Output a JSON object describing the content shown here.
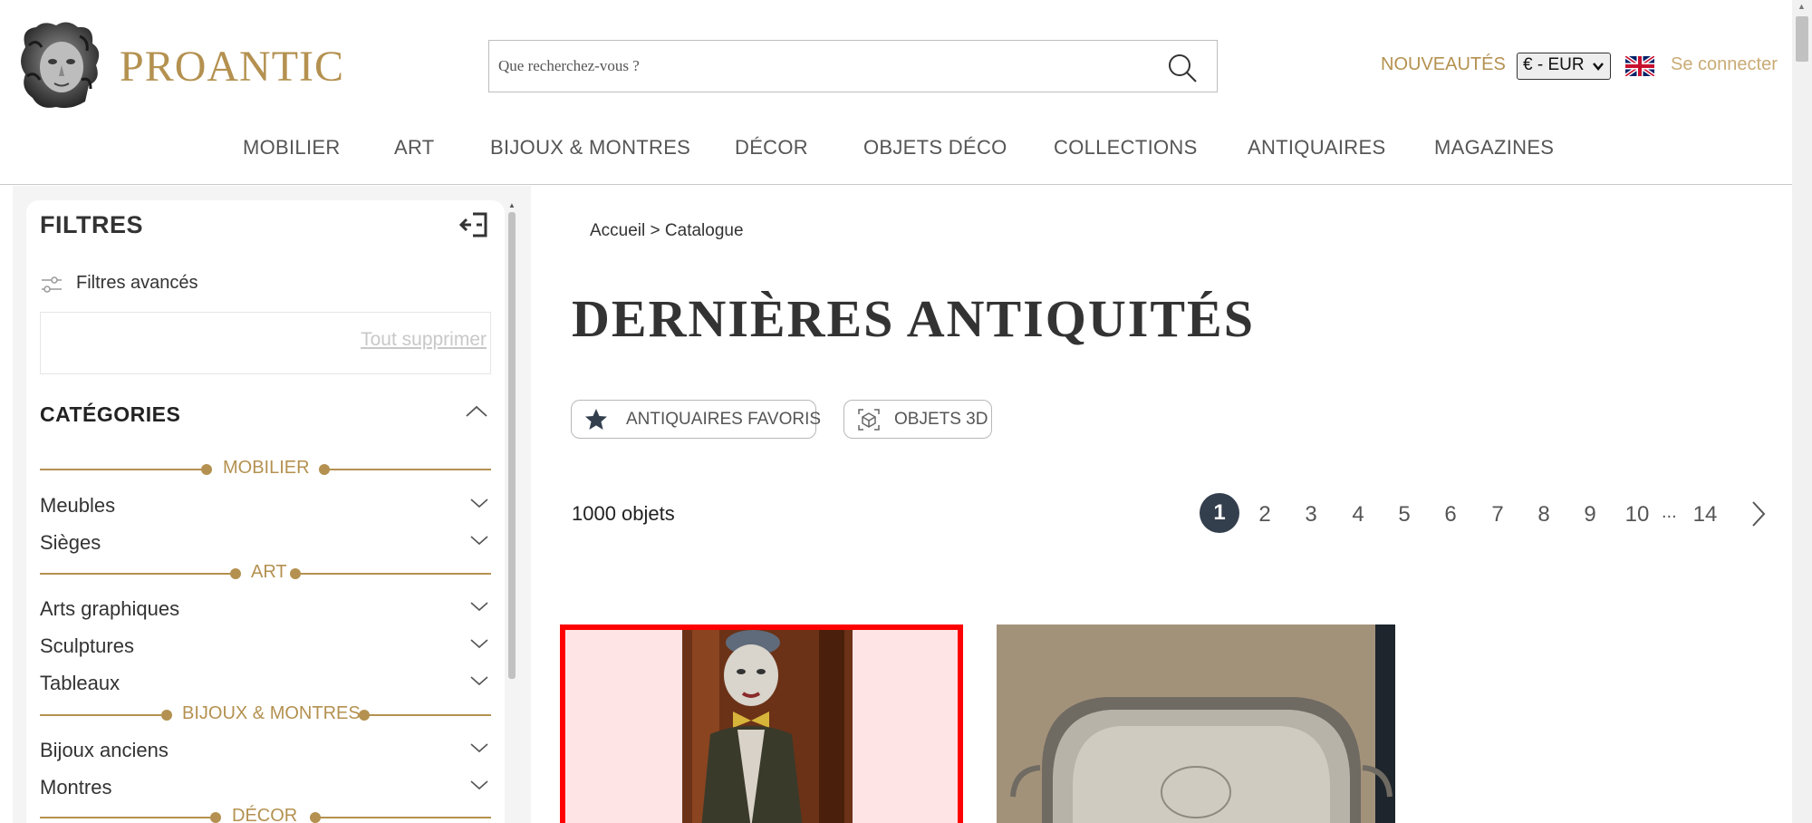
{
  "header": {
    "brand": "PROANTIC",
    "search_placeholder": "Que recherchez-vous ?",
    "news": "NOUVEAUTÉS",
    "currency": "€ - EUR",
    "login": "Se connecter"
  },
  "nav": [
    "MOBILIER",
    "ART",
    "BIJOUX & MONTRES",
    "DÉCOR",
    "OBJETS DÉCO",
    "COLLECTIONS",
    "ANTIQUAIRES",
    "MAGAZINES"
  ],
  "sidebar": {
    "title": "FILTRES",
    "advanced": "Filtres avancés",
    "clear_all": "Tout supprimer",
    "categories_title": "CATÉGORIES",
    "groups": {
      "mobilier": "MOBILIER",
      "art": "ART",
      "bijoux": "BIJOUX & MONTRES",
      "decor": "DÉCOR"
    },
    "items": {
      "meubles": "Meubles",
      "sieges": "Sièges",
      "arts_graphiques": "Arts graphiques",
      "sculptures": "Sculptures",
      "tableaux": "Tableaux",
      "bijoux_anciens": "Bijoux anciens",
      "montres": "Montres"
    }
  },
  "main": {
    "breadcrumb_home": "Accueil",
    "breadcrumb_sep": " > ",
    "breadcrumb_current": "Catalogue",
    "title": "DERNIÈRES ANTIQUITÉS",
    "fav_dealers": "ANTIQUAIRES FAVORIS",
    "objects_3d": "OBJETS 3D",
    "count": "1000 objets"
  },
  "pager": {
    "pages": [
      "1",
      "2",
      "3",
      "4",
      "5",
      "6",
      "7",
      "8",
      "9",
      "10",
      "14"
    ],
    "ellipsis": "...",
    "current": "1"
  },
  "colors": {
    "gold": "#b49150",
    "dark": "#343f4e",
    "highlight": "#ff0000"
  }
}
